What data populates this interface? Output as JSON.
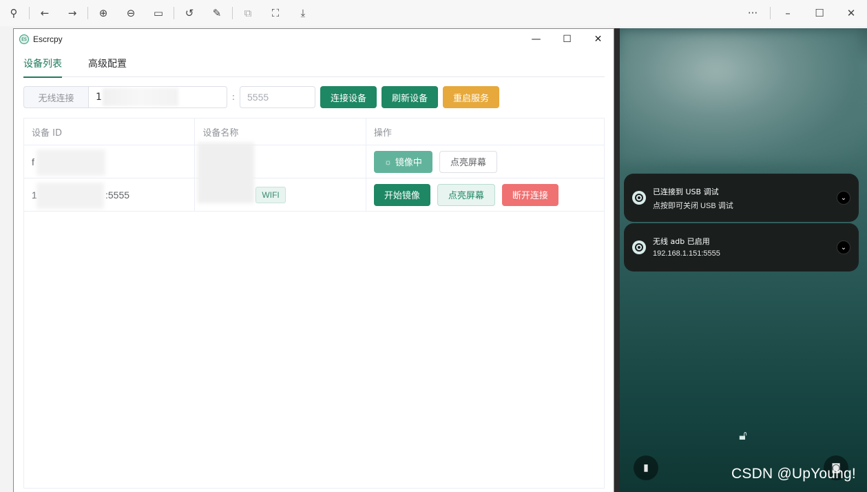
{
  "viewer": {
    "more_label": "···",
    "minimize_label": "–",
    "maximize_label": "☐",
    "close_label": "✕"
  },
  "app": {
    "title": "Escrcpy",
    "logo_text": "ES",
    "tabs": [
      "设备列表",
      "高级配置"
    ],
    "active_tab": 0,
    "connect": {
      "prefix": "无线连接",
      "ip_value": "1",
      "separator": ":",
      "port_placeholder": "5555",
      "buttons": {
        "connect": "连接设备",
        "refresh": "刷新设备",
        "restart": "重启服务"
      }
    },
    "table": {
      "headers": [
        "设备 ID",
        "设备名称",
        "操作"
      ],
      "rows": [
        {
          "id_prefix": "f",
          "id_suffix": "",
          "name_tag": "",
          "actions": [
            "镜像中",
            "点亮屏幕"
          ]
        },
        {
          "id_prefix": "1",
          "id_suffix": ":5555",
          "name_tag": "WIFI",
          "actions": [
            "开始镜像",
            "点亮屏幕",
            "断开连接"
          ]
        }
      ]
    }
  },
  "phone": {
    "notifications": [
      {
        "title": "已连接到 USB 调试",
        "subtitle": "点按即可关闭 USB 调试"
      },
      {
        "title": "无线 adb 已启用",
        "subtitle": "192.168.1.151:5555"
      }
    ]
  },
  "watermark": "CSDN @UpYoung!",
  "colors": {
    "accent": "#1e8764",
    "warning": "#e7a93b",
    "danger": "#ef7172"
  }
}
